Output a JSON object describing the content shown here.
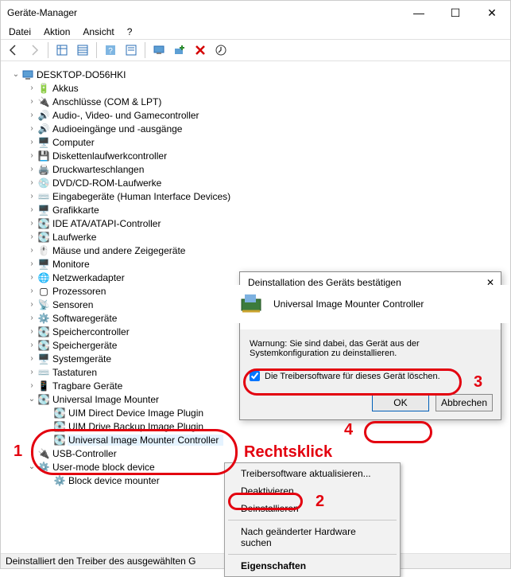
{
  "window": {
    "title": "Geräte-Manager",
    "minimize": "—",
    "maximize": "☐",
    "close": "✕"
  },
  "menu": {
    "file": "Datei",
    "action": "Aktion",
    "view": "Ansicht",
    "help": "?"
  },
  "tree": {
    "root": "DESKTOP-DO56HKI",
    "items": [
      "Akkus",
      "Anschlüsse (COM & LPT)",
      "Audio-, Video- und Gamecontroller",
      "Audioeingänge und -ausgänge",
      "Computer",
      "Diskettenlaufwerkcontroller",
      "Druckwarteschlangen",
      "DVD/CD-ROM-Laufwerke",
      "Eingabegeräte (Human Interface Devices)",
      "Grafikkarte",
      "IDE ATA/ATAPI-Controller",
      "Laufwerke",
      "Mäuse und andere Zeigegeräte",
      "Monitore",
      "Netzwerkadapter",
      "Prozessoren",
      "Sensoren",
      "Softwaregeräte",
      "Speichercontroller",
      "Speichergeräte",
      "Systemgeräte",
      "Tastaturen",
      "Tragbare Geräte"
    ],
    "expanded": {
      "label": "Universal Image Mounter",
      "children": [
        "UIM Direct Device Image Plugin",
        "UIM Drive Backup Image Plugin",
        "Universal Image Mounter Controller"
      ]
    },
    "after": [
      "USB-Controller"
    ],
    "umbd": {
      "label": "User-mode block device",
      "child": "Block device mounter"
    }
  },
  "context": {
    "updateDriver": "Treibersoftware aktualisieren...",
    "deactivate": "Deaktivieren",
    "uninstall": "Deinstallieren",
    "scan": "Nach geänderter Hardware suchen",
    "properties": "Eigenschaften"
  },
  "dialog": {
    "title": "Deinstallation des Geräts bestätigen",
    "close": "✕",
    "device": "Universal Image Mounter Controller",
    "warning": "Warnung: Sie sind dabei, das Gerät aus der Systemkonfiguration zu deinstallieren.",
    "checkbox": "Die Treibersoftware für dieses Gerät löschen.",
    "ok": "OK",
    "cancel": "Abbrechen"
  },
  "status": "Deinstalliert den Treiber des ausgewählten G",
  "annotations": {
    "one": "1",
    "two": "2",
    "three": "3",
    "four": "4",
    "rightclick": "Rechtsklick"
  }
}
